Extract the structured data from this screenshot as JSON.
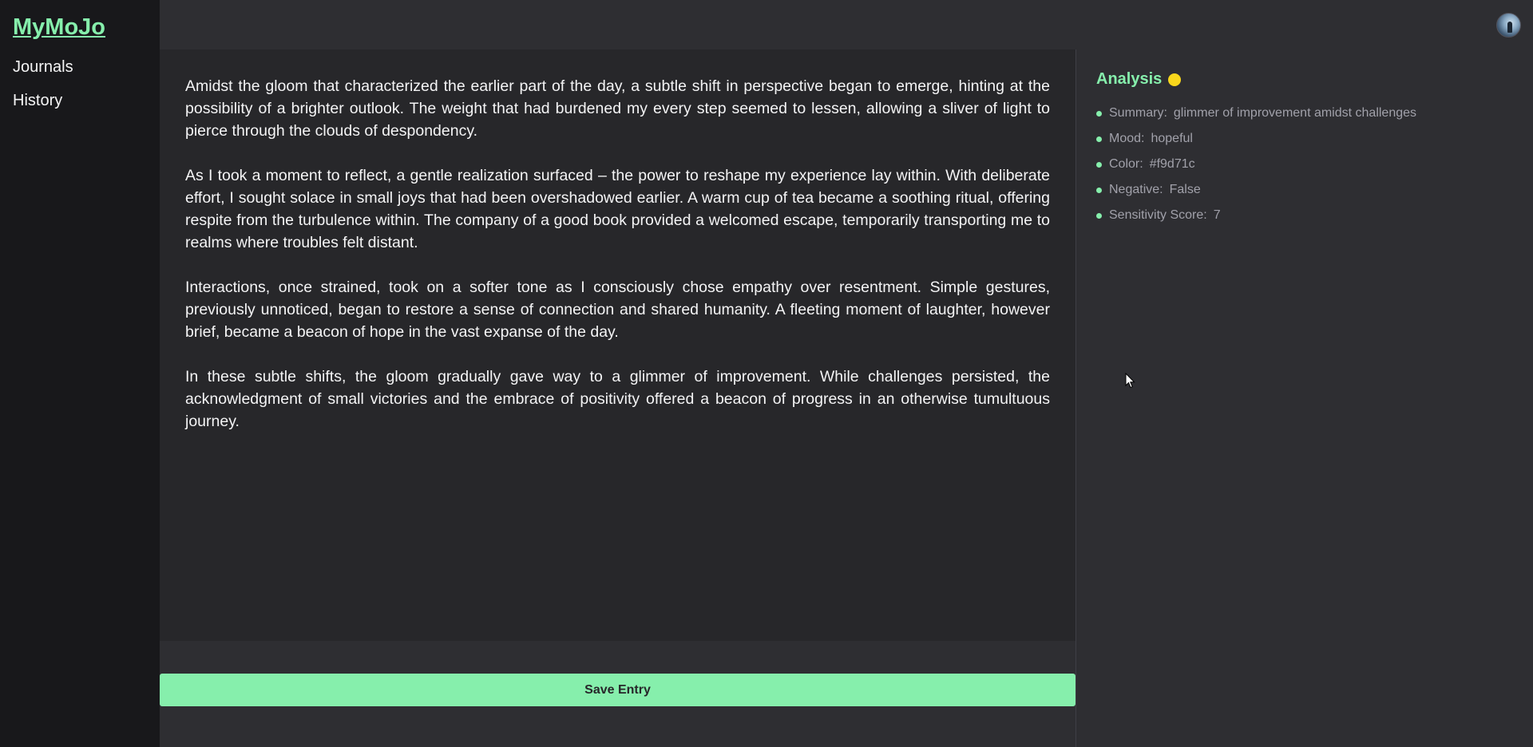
{
  "app": {
    "logo": "MyMoJo"
  },
  "sidebar": {
    "items": [
      {
        "label": "Journals"
      },
      {
        "label": "History"
      }
    ]
  },
  "header": {
    "avatar_icon": "user-avatar"
  },
  "editor": {
    "paragraphs": [
      "Amidst the gloom that characterized the earlier part of the day, a subtle shift in perspective began to emerge, hinting at the possibility of a brighter outlook. The weight that had burdened my every step seemed to lessen, allowing a sliver of light to pierce through the clouds of despondency.",
      "As I took a moment to reflect, a gentle realization surfaced – the power to reshape my experience lay within. With deliberate effort, I sought solace in small joys that had been overshadowed earlier. A warm cup of tea became a soothing ritual, offering respite from the turbulence within. The company of a good book provided a welcomed escape, temporarily transporting me to realms where troubles felt distant.",
      "Interactions, once strained, took on a softer tone as I consciously chose empathy over resentment. Simple gestures, previously unnoticed, began to restore a sense of connection and shared humanity. A fleeting moment of laughter, however brief, became a beacon of hope in the vast expanse of the day.",
      "In these subtle shifts, the gloom gradually gave way to a glimmer of improvement. While challenges persisted, the acknowledgment of small victories and the embrace of positivity offered a beacon of progress in an otherwise tumultuous journey."
    ]
  },
  "footer": {
    "save_label": "Save Entry"
  },
  "analysis": {
    "title": "Analysis",
    "mood_color": "#f9d71c",
    "items": [
      {
        "key": "Summary:",
        "value": "glimmer of improvement amidst challenges"
      },
      {
        "key": "Mood:",
        "value": "hopeful"
      },
      {
        "key": "Color:",
        "value": "#f9d71c"
      },
      {
        "key": "Negative:",
        "value": "False"
      },
      {
        "key": "Sensitivity Score:",
        "value": "7"
      }
    ]
  },
  "colors": {
    "accent": "#86efac",
    "sidebar_bg": "#18181b",
    "panel_bg": "#2e2e32",
    "editor_bg": "#27272a"
  }
}
